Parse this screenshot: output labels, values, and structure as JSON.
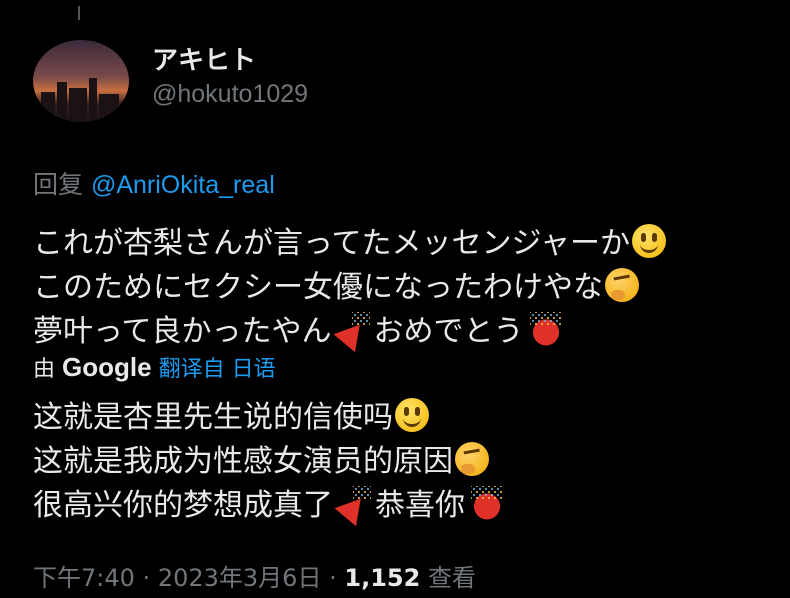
{
  "author": {
    "display_name": "アキヒト",
    "handle": "@hokuto1029"
  },
  "reply": {
    "prefix": "回复",
    "mention": "@AnriOkita_real"
  },
  "tweet": {
    "lines": [
      "これが杏梨さんが言ってたメッセンジャーか",
      "このためにセクシー女優になったわけやな",
      "夢叶って良かったやん",
      "おめでとう"
    ]
  },
  "translation": {
    "by_label": "由",
    "provider": "Google",
    "link": "翻译自 日语",
    "lines": [
      "这就是杏里先生说的信使吗",
      "这就是我成为性感女演员的原因",
      "很高兴你的梦想成真了",
      "恭喜你"
    ]
  },
  "meta": {
    "time": "下午7:40",
    "date": "2023年3月6日",
    "views_count": "1,152",
    "views_label": "查看"
  },
  "icons": [
    "grinning-face-icon",
    "thinking-face-icon",
    "party-popper-icon",
    "confetti-ball-icon"
  ]
}
